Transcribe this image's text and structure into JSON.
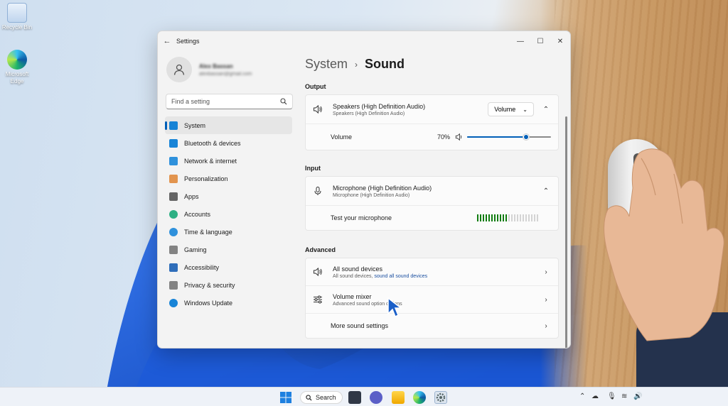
{
  "desktop": {
    "icons": [
      {
        "label": "Recycle Bin",
        "icon": "recycle-bin-icon"
      },
      {
        "label": "Microsoft Edge",
        "icon": "edge-icon"
      }
    ]
  },
  "window": {
    "title": "Settings",
    "controls": {
      "minimize": "—",
      "maximize": "☐",
      "close": "✕"
    }
  },
  "profile": {
    "name": "Alex Bassan",
    "email": "alexbassan@gmail.com"
  },
  "search": {
    "placeholder": "Find a setting"
  },
  "nav": {
    "items": [
      {
        "label": "System",
        "icon": "system-icon",
        "selected": true,
        "color": "#0078d4"
      },
      {
        "label": "Bluetooth & devices",
        "icon": "bluetooth-icon",
        "color": "#0078d4"
      },
      {
        "label": "Network & internet",
        "icon": "wifi-icon",
        "color": "#1a86d9"
      },
      {
        "label": "Personalization",
        "icon": "brush-icon",
        "color": "#e08a3c"
      },
      {
        "label": "Apps",
        "icon": "apps-icon",
        "color": "#555555"
      },
      {
        "label": "Accounts",
        "icon": "accounts-icon",
        "color": "#18a878"
      },
      {
        "label": "Time & language",
        "icon": "globe-icon",
        "color": "#1a86d9"
      },
      {
        "label": "Gaming",
        "icon": "controller-icon",
        "color": "#777777"
      },
      {
        "label": "Accessibility",
        "icon": "accessibility-icon",
        "color": "#1a5fb4"
      },
      {
        "label": "Privacy & security",
        "icon": "shield-icon",
        "color": "#777777"
      },
      {
        "label": "Windows Update",
        "icon": "update-icon",
        "color": "#0078d4"
      }
    ]
  },
  "breadcrumb": {
    "parent": "System",
    "separator": "›",
    "current": "Sound"
  },
  "output": {
    "heading": "Output",
    "device": {
      "name": "Speakers (High Definition Audio)",
      "sub": "Speakers (High Definition Audio)",
      "dropdown": "Volume"
    },
    "volume": {
      "label": "Volume",
      "value_text": "70%",
      "value": 0.7
    }
  },
  "input": {
    "heading": "Input",
    "device": {
      "name": "Microphone (High Definition Audio)",
      "sub": "Microphone (High Definition Audio)"
    },
    "test": {
      "label": "Test your microphone",
      "level_segments_on": 11,
      "level_segments_total": 22
    }
  },
  "advanced": {
    "heading": "Advanced",
    "rows": [
      {
        "title": "All sound devices",
        "sub_prefix": "All sound devices, ",
        "sub_link": "sound all sound devices",
        "icon": "speaker-icon"
      },
      {
        "title": "Volume mixer",
        "sub": "Advanced sound option options",
        "icon": "mixer-icon"
      },
      {
        "title": "More sound settings"
      }
    ]
  },
  "taskbar": {
    "search_label": "Search",
    "apps": [
      "windows-start-icon",
      "task-view-icon",
      "chat-icon",
      "file-explorer-icon",
      "edge-icon",
      "settings-icon"
    ]
  },
  "colors": {
    "accent": "#005fb8",
    "mic_level": "#107c10"
  }
}
